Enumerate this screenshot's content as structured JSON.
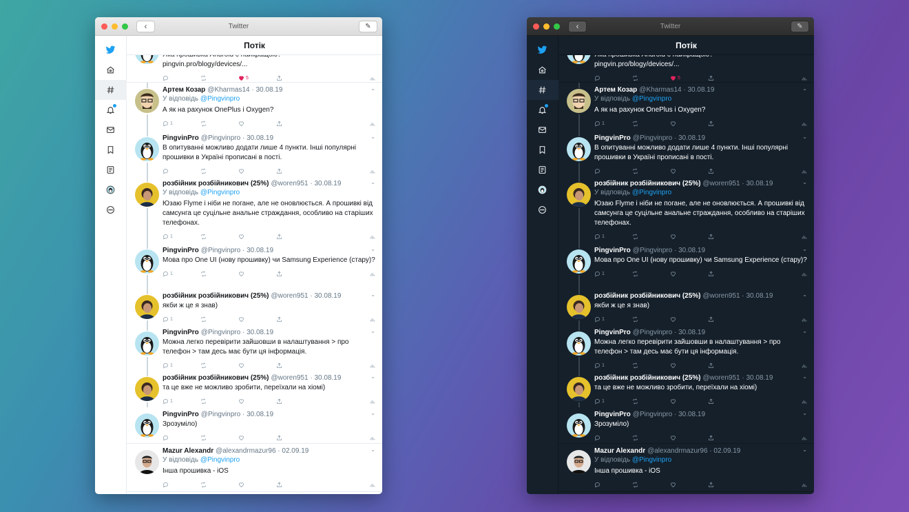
{
  "window": {
    "title": "Twitter",
    "back_icon": "chevron-left-icon",
    "compose_icon": "compose-icon"
  },
  "timeline": {
    "title": "Потік"
  },
  "sidebar": [
    {
      "name": "twitter-logo-icon"
    },
    {
      "name": "home-icon"
    },
    {
      "name": "explore-hashtag-icon",
      "active": true
    },
    {
      "name": "notifications-bell-icon",
      "badge": true
    },
    {
      "name": "messages-envelope-icon"
    },
    {
      "name": "bookmarks-icon"
    },
    {
      "name": "lists-icon"
    },
    {
      "name": "profile-avatar-icon"
    },
    {
      "name": "more-icon"
    }
  ],
  "tweets": [
    {
      "partial": true,
      "text": "Яка прошивка Android є найкращою?",
      "link": "pingvin.pro/blogy/devices/...",
      "actions": {
        "reply": "",
        "retweet": "",
        "like": "5",
        "liked": true
      }
    },
    {
      "name": "Артем Козар",
      "handle": "@Kharmas14",
      "date": "30.08.19",
      "reply_prefix": "У відповідь",
      "reply_to": "@Pingvinpro",
      "text": "А як на рахунок OnePlus і Oxygen?",
      "actions": {
        "reply": "1",
        "retweet": "",
        "like": ""
      }
    },
    {
      "name": "PingvinPro",
      "handle": "@Pingvinpro",
      "date": "30.08.19",
      "text": "В опитуванні можливо додати лише 4 пункти. Інші популярні прошивки в Україні прописані в пості.",
      "actions": {
        "reply": "",
        "retweet": "",
        "like": ""
      }
    },
    {
      "name": "розбійник розбійникович (25%)",
      "handle": "@woren951",
      "date": "30.08.19",
      "reply_prefix": "У відповідь",
      "reply_to": "@Pingvinpro",
      "text": "Юзаю Flyme і ніби не погане, але не оновлюється. А прошивкі від самсунга це суцільне анальне страждання, особливо на старіших телефонах.",
      "actions": {
        "reply": "1",
        "retweet": "",
        "like": ""
      }
    },
    {
      "name": "PingvinPro",
      "handle": "@Pingvinpro",
      "date": "30.08.19",
      "text": "Мова про One UI (нову прошивку) чи Samsung Experience (стару)?",
      "actions": {
        "reply": "1",
        "retweet": "",
        "like": ""
      }
    },
    {
      "name": "розбійник розбійникович (25%)",
      "handle": "@woren951",
      "date": "30.08.19",
      "text": "якби ж це я знав)",
      "actions": {
        "reply": "1",
        "retweet": "",
        "like": ""
      }
    },
    {
      "name": "PingvinPro",
      "handle": "@Pingvinpro",
      "date": "30.08.19",
      "text": "Можна легко перевірити зайшовши в налаштування > про телефон > там десь має бути ця інформація.",
      "actions": {
        "reply": "1",
        "retweet": "",
        "like": ""
      }
    },
    {
      "name": "розбійник розбійникович (25%)",
      "handle": "@woren951",
      "date": "30.08.19",
      "text": "та це вже не можливо зробити, переїхали на хіомі)",
      "actions": {
        "reply": "1",
        "retweet": "",
        "like": ""
      }
    },
    {
      "name": "PingvinPro",
      "handle": "@Pingvinpro",
      "date": "30.08.19",
      "text": "Зрозуміло)",
      "actions": {
        "reply": "",
        "retweet": "",
        "like": ""
      }
    },
    {
      "name": "Mazur Alexandr",
      "handle": "@alexandrmazur96",
      "date": "02.09.19",
      "reply_prefix": "У відповідь",
      "reply_to": "@Pingvinpro",
      "text": "Інша прошивка - iOS",
      "actions": {
        "reply": "",
        "retweet": "",
        "like": ""
      }
    }
  ],
  "colors": {
    "accent": "#1da1f2",
    "like": "#e0245e",
    "dark_bg": "#15202b"
  }
}
